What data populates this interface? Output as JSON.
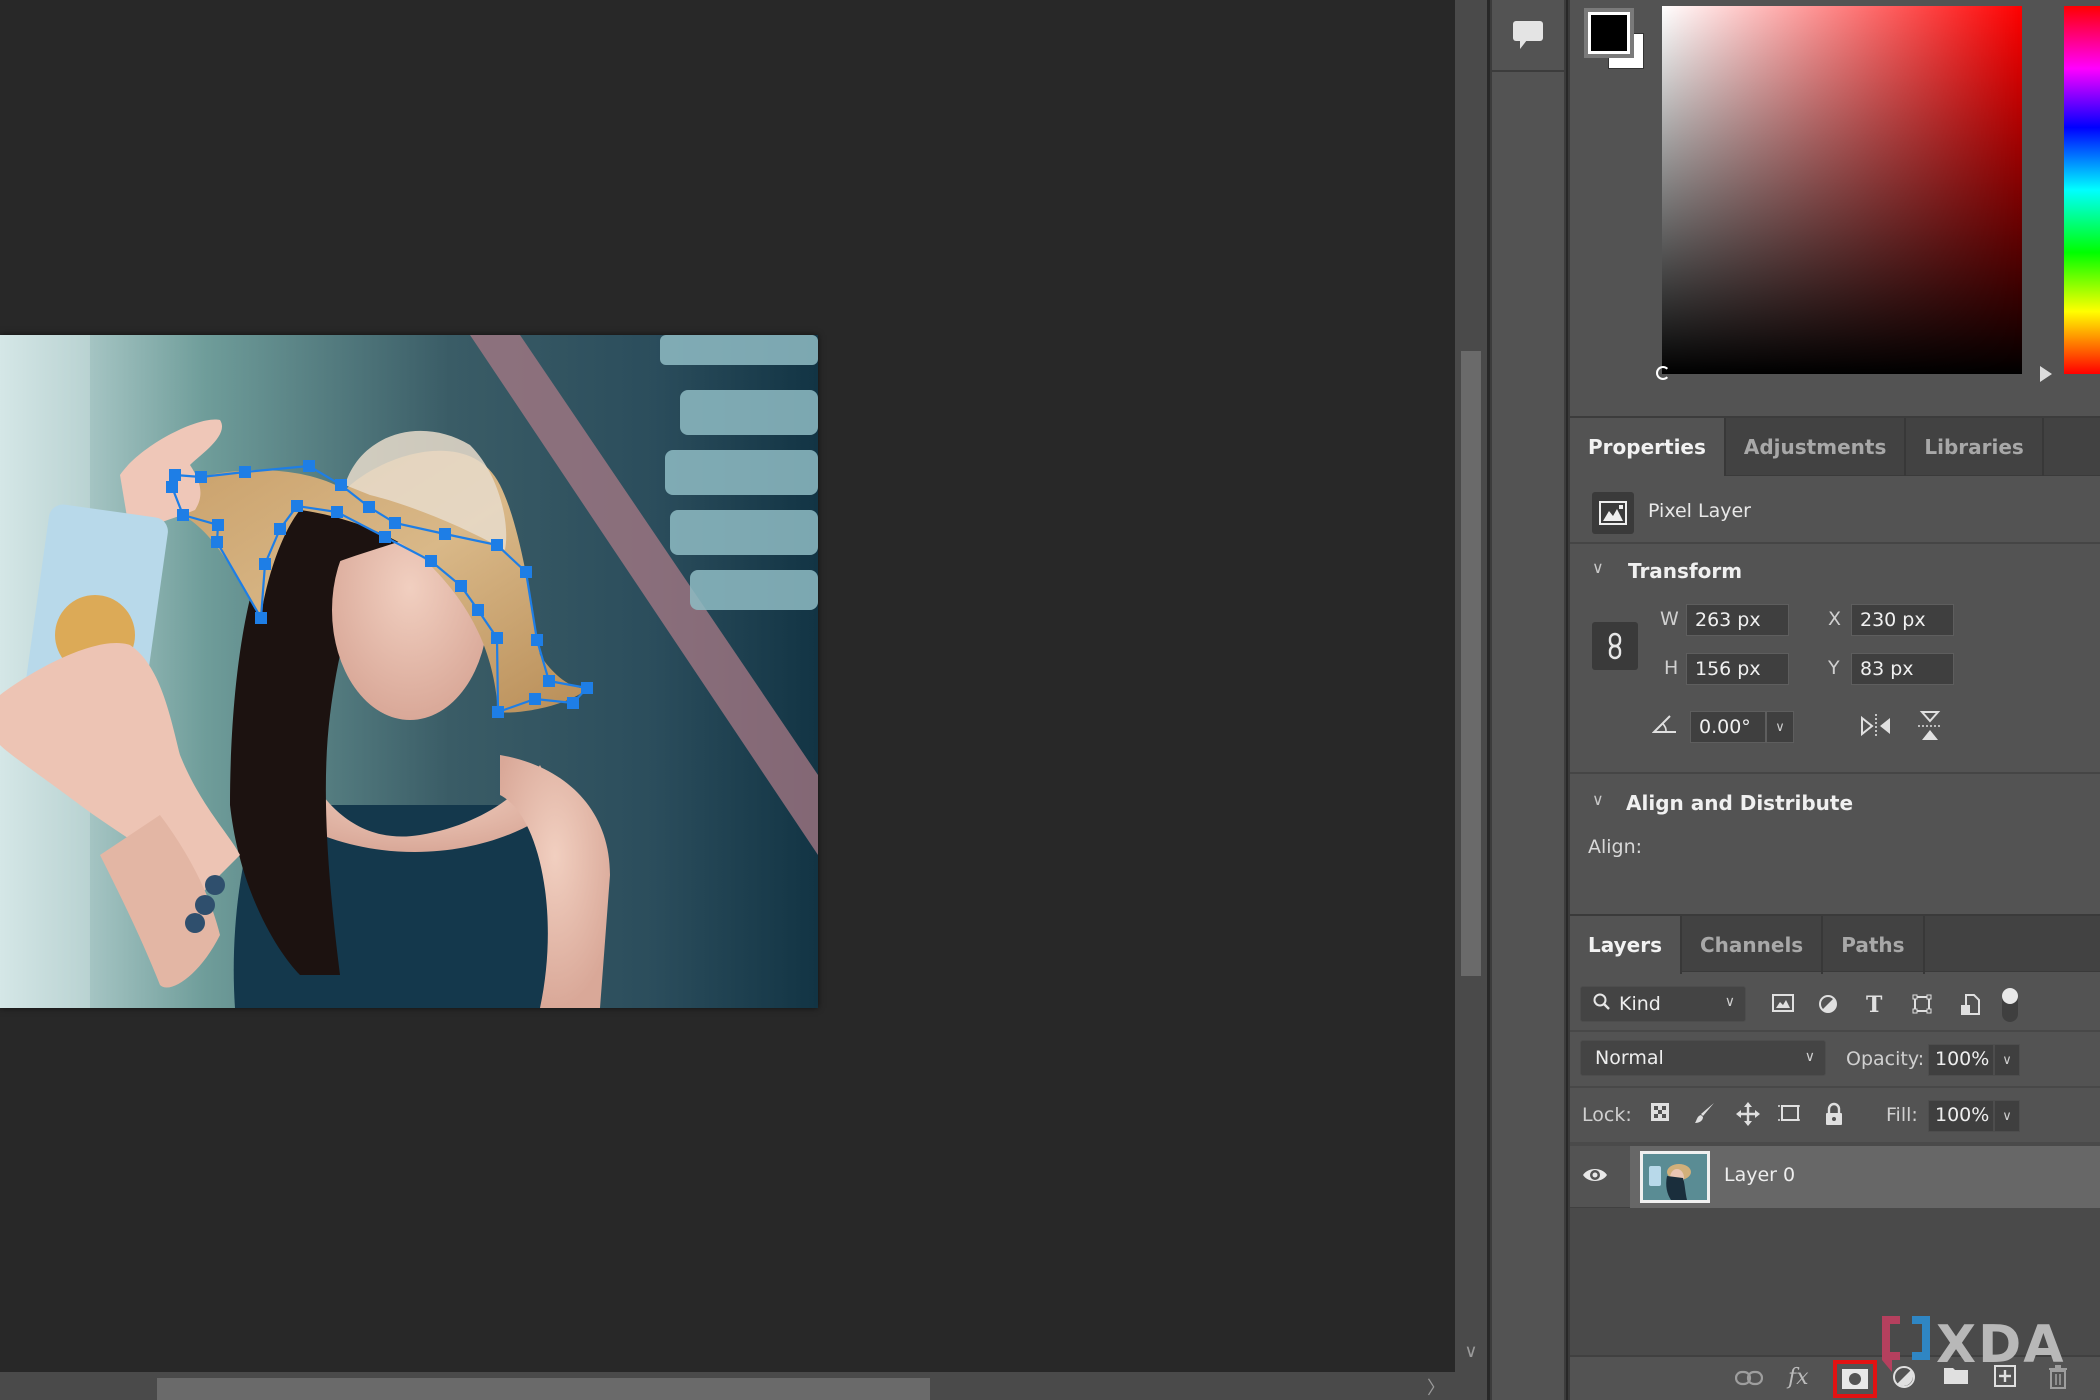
{
  "canvas": {
    "document_label": "photo-canvas",
    "path_color": "#1e7ee6"
  },
  "scrollbars": {
    "vertical_down_arrow": "∨",
    "horizontal_right_arrow": "〉"
  },
  "toolcolumn": {
    "comment_icon": "comment-icon"
  },
  "color": {
    "foreground": "#000000",
    "background": "#ffffff",
    "hue": "#ff0000"
  },
  "properties": {
    "tabs": [
      {
        "label": "Properties",
        "active": true
      },
      {
        "label": "Adjustments",
        "active": false
      },
      {
        "label": "Libraries",
        "active": false
      }
    ],
    "layer_type": "Pixel Layer",
    "transform": {
      "title": "Transform",
      "w_label": "W",
      "w_value": "263 px",
      "h_label": "H",
      "h_value": "156 px",
      "x_label": "X",
      "x_value": "230 px",
      "y_label": "Y",
      "y_value": "83 px",
      "angle_value": "0.00°"
    },
    "align": {
      "title": "Align and Distribute",
      "label": "Align:"
    }
  },
  "layers": {
    "tabs": [
      {
        "label": "Layers",
        "active": true
      },
      {
        "label": "Channels",
        "active": false
      },
      {
        "label": "Paths",
        "active": false
      }
    ],
    "filter_kind": "Kind",
    "blend_mode": "Normal",
    "opacity_label": "Opacity:",
    "opacity_value": "100%",
    "lock_label": "Lock:",
    "fill_label": "Fill:",
    "fill_value": "100%",
    "items": [
      {
        "name": "Layer 0",
        "visible": true,
        "selected": true
      }
    ],
    "footer_highlight_color": "#e31212"
  },
  "watermark": {
    "text": "XDA",
    "bracket_left_color": "#b5405e",
    "bracket_right_color": "#2f86c4"
  }
}
